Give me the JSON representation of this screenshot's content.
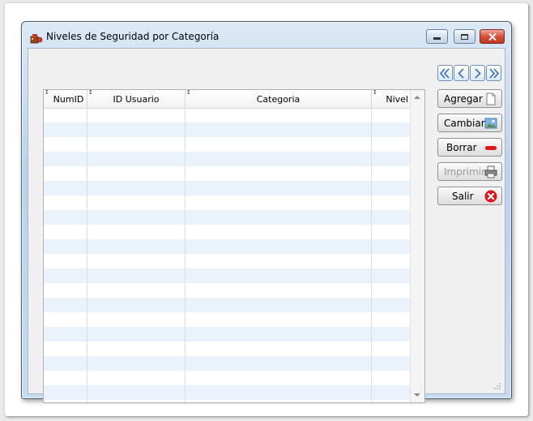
{
  "window": {
    "title": "Niveles de Seguridad por Categoría"
  },
  "grid": {
    "columns": [
      "NumID",
      "ID Usuario",
      "Categoria",
      "Nivel"
    ],
    "sort_indicator": "↕",
    "row_count": 20
  },
  "navigation": {
    "buttons": [
      "first-record-icon",
      "previous-record-icon",
      "next-record-icon",
      "last-record-icon"
    ]
  },
  "actions": {
    "add_label": "Agregar",
    "change_label": "Cambiar",
    "delete_label": "Borrar",
    "print_label": "Imprimir",
    "exit_label": "Salir"
  },
  "colors": {
    "row_alt": "#eaf2fb",
    "nav_arrow": "#3a6fb8",
    "delete_red": "#e0151b",
    "exit_red": "#e0151b"
  }
}
